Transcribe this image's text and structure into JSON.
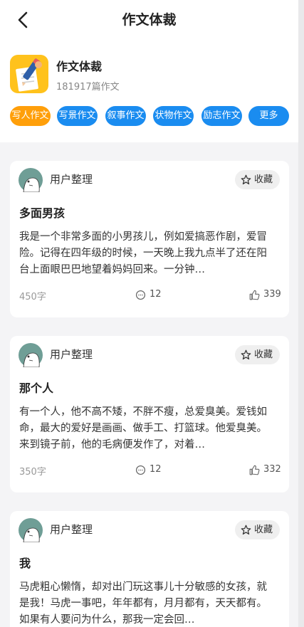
{
  "header": {
    "title": "作文体裁"
  },
  "category": {
    "name": "作文体裁",
    "count": "181917篇作文"
  },
  "tags": [
    "写人作文",
    "写景作文",
    "叙事作文",
    "状物作文",
    "励志作文",
    "更多"
  ],
  "colors": {
    "accent": "#1a8cf0",
    "active_tag": "#ff9f0a",
    "page_bg": "#f4f4f6"
  },
  "cards": [
    {
      "author": "用户整理",
      "favorite_label": "收藏",
      "title": "多面男孩",
      "excerpt": "我是一个非常多面的小男孩儿，例如爱搞恶作剧，爱冒险。记得在四年级的时候，一天晚上我九点半了还在阳台上面眼巴巴地望着妈妈回来。一分钟…",
      "word_count": "450字",
      "comments": "12",
      "likes": "339"
    },
    {
      "author": "用户整理",
      "favorite_label": "收藏",
      "title": "那个人",
      "excerpt": "有一个人，他不高不矮，不胖不瘦，总爱臭美。爱钱如命，最大的爱好是画画、做手工、打篮球。他爱臭美。来到镜子前，他的毛病便发作了，对着…",
      "word_count": "350字",
      "comments": "12",
      "likes": "332"
    },
    {
      "author": "用户整理",
      "favorite_label": "收藏",
      "title": "我",
      "excerpt": "马虎粗心懒惰，却对出门玩这事儿十分敏感的女孩，就是我！马虎一事吧，年年都有，月月都有，天天都有。如果有人要问为什么，那我一定会回…",
      "word_count": "",
      "comments": "",
      "likes": ""
    }
  ]
}
